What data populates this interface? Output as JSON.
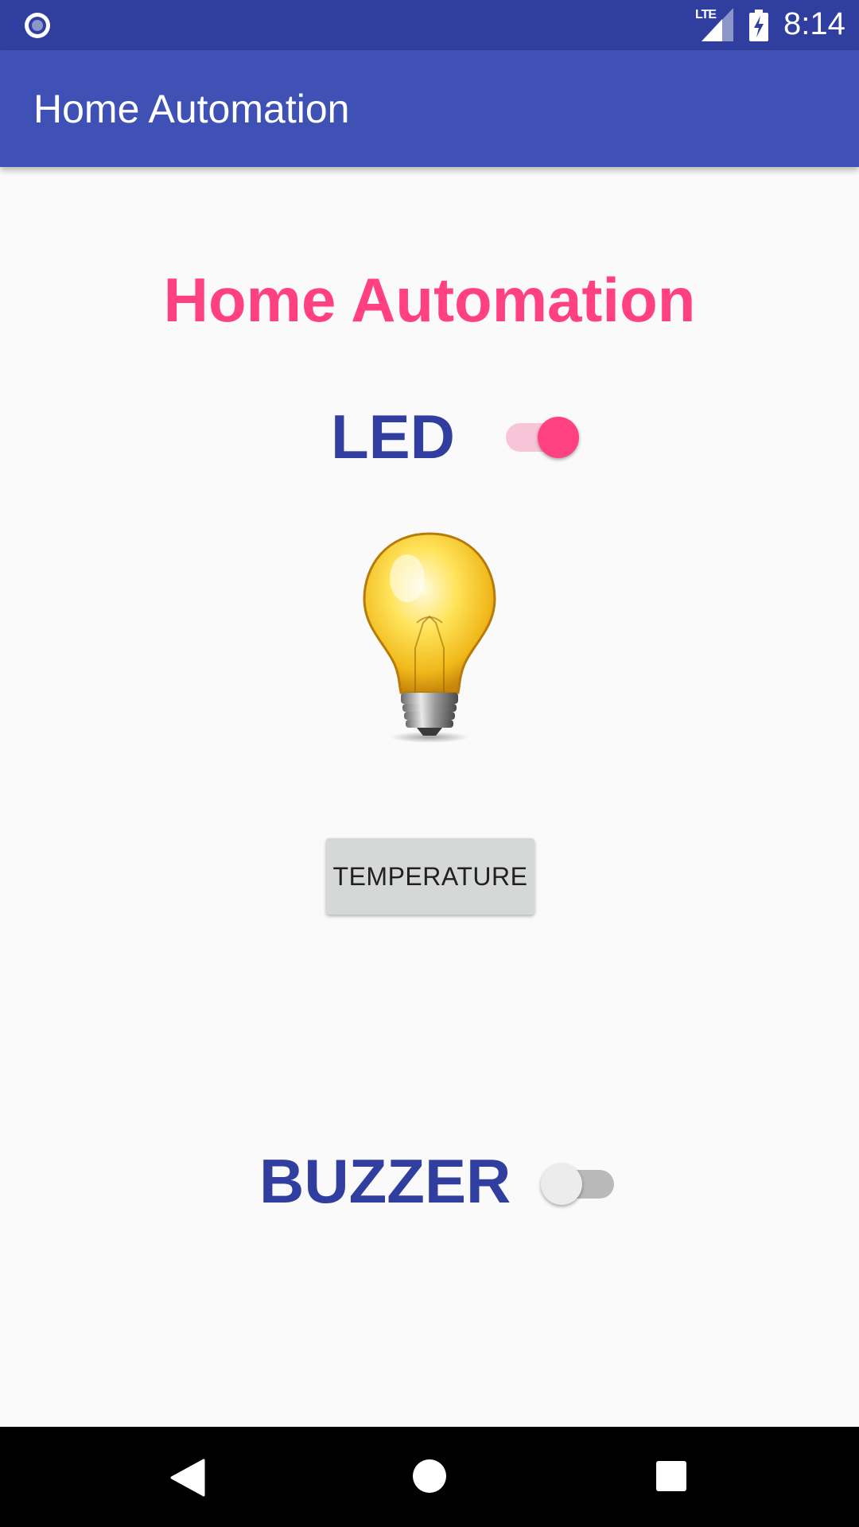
{
  "status_bar": {
    "left_icon": "radio-circle-icon",
    "network": "LTE",
    "battery_icon": "battery-charging-icon",
    "time": "8:14"
  },
  "app_bar": {
    "title": "Home Automation"
  },
  "main": {
    "heading": "Home Automation",
    "led": {
      "label": "LED",
      "switch_on": true
    },
    "bulb_icon": "light-bulb-icon",
    "temperature_button": "TEMPERATURE",
    "buzzer": {
      "label": "BUZZER",
      "switch_on": false
    }
  },
  "nav_bar": {
    "back_icon": "back-icon",
    "home_icon": "home-icon",
    "recents_icon": "recents-icon"
  },
  "colors": {
    "status_bar": "#303f9f",
    "app_bar": "#3f51b5",
    "accent": "#ff4081",
    "label": "#303f9f",
    "background": "#fafafa"
  }
}
